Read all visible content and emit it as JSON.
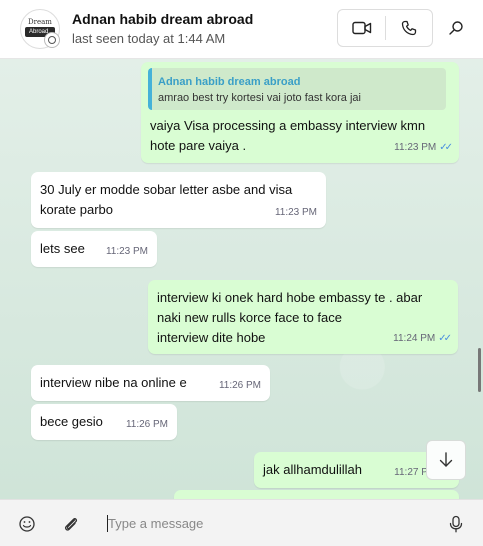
{
  "header": {
    "contact_name": "Adnan habib dream abroad",
    "status": "last seen today at 1:44 AM",
    "avatar_logo_top": "Dream",
    "avatar_logo_bottom": "Abroad",
    "icons": {
      "video": "video-call-icon",
      "voice": "phone-icon",
      "search": "search-icon"
    }
  },
  "messages": [
    {
      "direction": "out",
      "quote_name": "Adnan habib dream abroad",
      "quote_text": "amrao best try kortesi vai joto fast kora jai",
      "text": "vaiya Visa processing a embassy interview kmn\nhote pare vaiya .",
      "time": "11:23 PM",
      "read": true
    },
    {
      "direction": "in",
      "text": "30 July er modde sobar letter asbe and visa\nkorate parbo",
      "time": "11:23 PM"
    },
    {
      "direction": "in",
      "text": "lets see",
      "time": "11:23 PM"
    },
    {
      "direction": "out",
      "text": "interview ki onek hard hobe embassy te . abar\nnaki new rulls korce face to face\ninterview dite hobe",
      "time": "11:24 PM",
      "read": true
    },
    {
      "direction": "in",
      "text": "interview nibe na online e",
      "time": "11:26 PM"
    },
    {
      "direction": "in",
      "text": "bece gesio",
      "time": "11:26 PM"
    },
    {
      "direction": "out",
      "text": "jak allhamdulillah",
      "time": "11:27 PM",
      "read": true
    }
  ],
  "composer": {
    "placeholder": "Type a message",
    "icons": {
      "emoji": "emoji-icon",
      "attach": "paperclip-icon",
      "mic": "microphone-icon"
    }
  },
  "colors": {
    "chat_bg": "#dcebe3",
    "outgoing": "#d9fdd3",
    "incoming": "#ffffff",
    "read_ticks": "#4a8fe0",
    "quote_bar": "#45b2d8"
  }
}
